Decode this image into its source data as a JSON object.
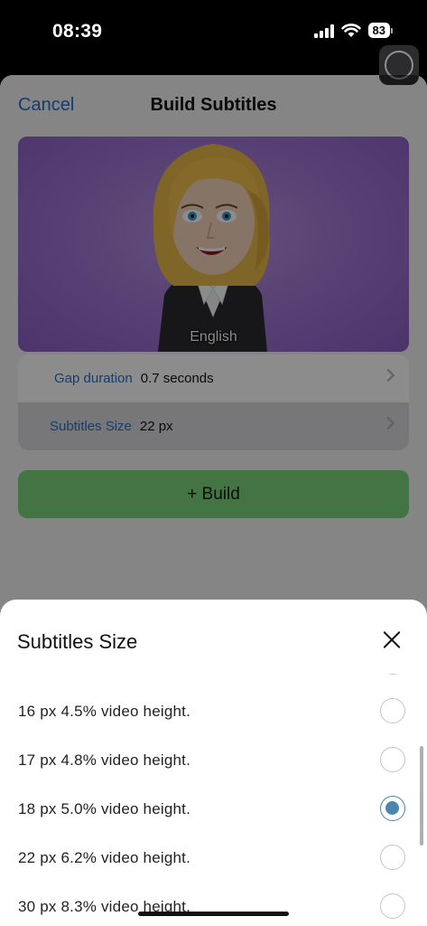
{
  "status_bar": {
    "time": "08:39",
    "battery": "83",
    "icons": [
      "signal-icon",
      "wifi-icon",
      "battery-icon"
    ]
  },
  "background_sheet": {
    "cancel_label": "Cancel",
    "title": "Build Subtitles",
    "video": {
      "caption": "English"
    },
    "settings": [
      {
        "label": "Gap duration",
        "value": "0.7 seconds"
      },
      {
        "label": "Subtitles Size",
        "value": "22 px"
      }
    ],
    "build_label": "+ Build"
  },
  "bottom_sheet": {
    "title": "Subtitles Size",
    "options": [
      {
        "label": "16 px 4.5% video height.",
        "selected": false
      },
      {
        "label": "17 px 4.8% video height.",
        "selected": false
      },
      {
        "label": "18 px 5.0% video height.",
        "selected": true
      },
      {
        "label": "22 px 6.2% video height.",
        "selected": false
      },
      {
        "label": "30 px 8.3% video height.",
        "selected": false
      }
    ]
  },
  "colors": {
    "link_blue": "#1f6fd0",
    "build_green": "#7ed37d",
    "radio_selected": "#4a86ad",
    "video_bg": "#9d74d2"
  }
}
